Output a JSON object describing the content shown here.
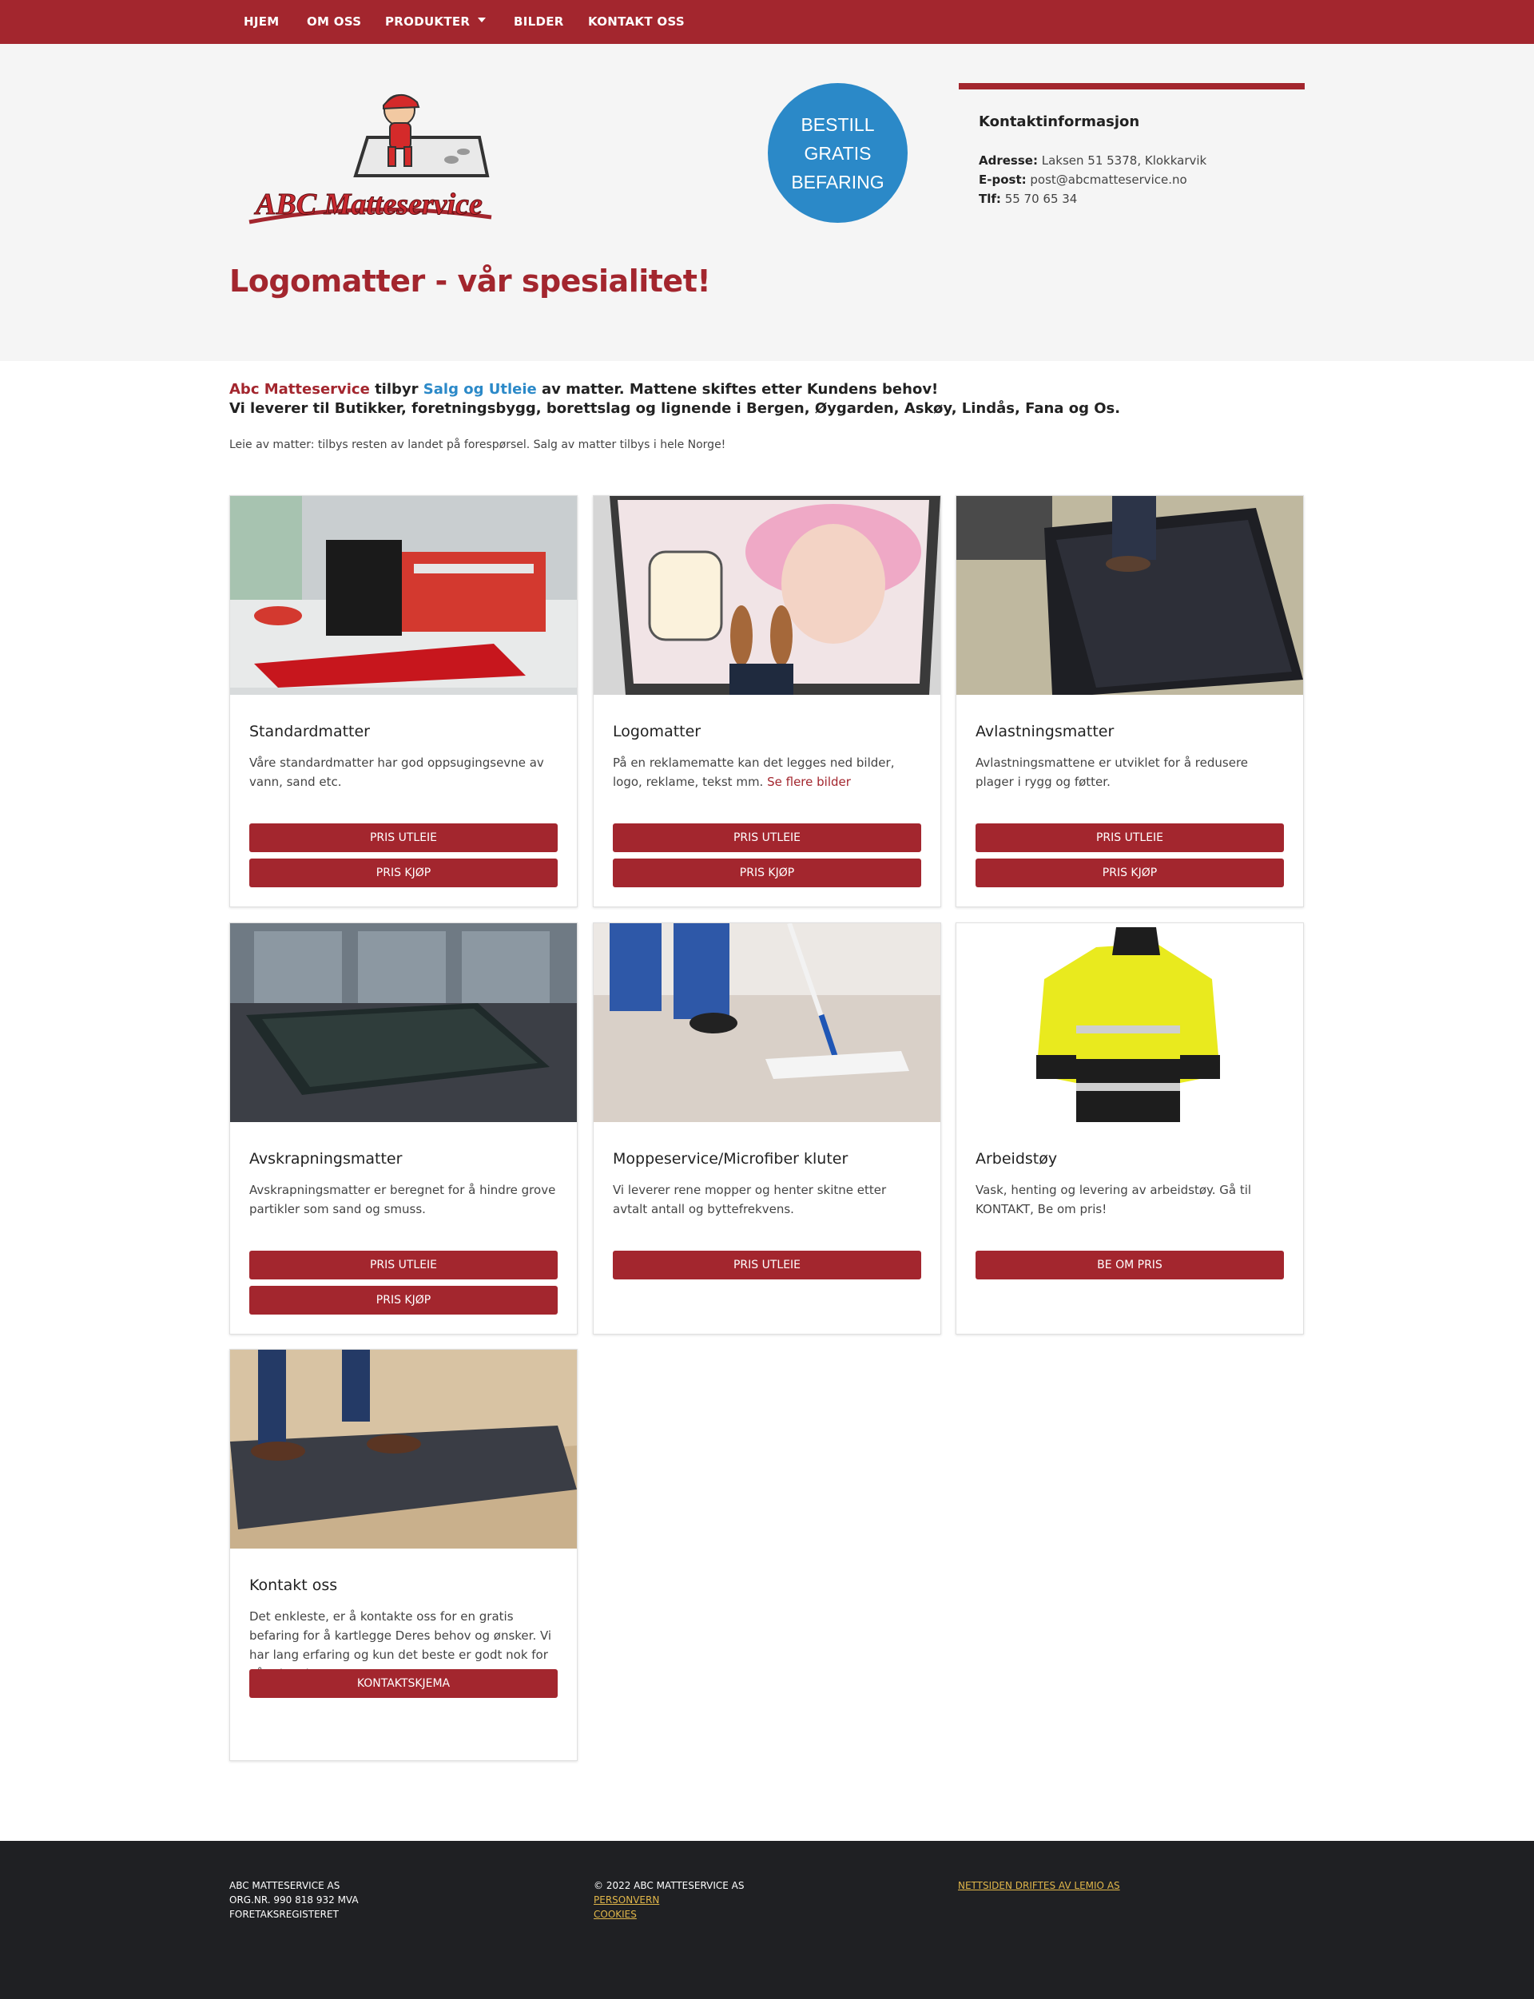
{
  "nav": {
    "items": [
      "HJEM",
      "OM OSS",
      "PRODUKTER",
      "BILDER",
      "KONTAKT OSS"
    ]
  },
  "logo": {
    "text": "ABC Matteservice"
  },
  "cta": {
    "line1": "BESTILL",
    "line2": "GRATIS",
    "line3": "BEFARING"
  },
  "contact": {
    "title": "Kontaktinformasjon",
    "address_label": "Adresse:",
    "address": "Laksen 51 5378, Klokkarvik",
    "email_label": "E-post:",
    "email": "post@abcmatteservice.no",
    "phone_label": "Tlf:",
    "phone": "55 70 65 34"
  },
  "headline": "Logomatter - vår spesialitet!",
  "intro": {
    "brand": "Abc Matteservice",
    "mid1": " tilbyr ",
    "services": "Salg og Utleie",
    "mid2": " av matter. Mattene skiftes etter Kundens behov!",
    "line2": "Vi leverer til Butikker, foretningsbygg, borettslag og lignende i Bergen, Øygarden, Askøy, Lindås, Fana og Os.",
    "note": "Leie av matter: tilbys resten av landet på forespørsel. Salg av matter tilbys i hele Norge!"
  },
  "cards": [
    {
      "title": "Standardmatter",
      "desc": "Våre standardmatter har god oppsugingsevne av vann, sand etc.",
      "buttons": [
        "PRIS UTLEIE",
        "PRIS KJØP"
      ]
    },
    {
      "title": "Logomatter",
      "desc": "På en reklamematte kan det legges ned bilder, logo, reklame, tekst mm.",
      "link": "Se flere bilder",
      "buttons": [
        "PRIS UTLEIE",
        "PRIS KJØP"
      ]
    },
    {
      "title": "Avlastningsmatter",
      "desc": "Avlastningsmattene er utviklet for å redusere plager i rygg og føtter.",
      "buttons": [
        "PRIS UTLEIE",
        "PRIS KJØP"
      ]
    },
    {
      "title": "Avskrapningsmatter",
      "desc": "Avskrapningsmatter er beregnet for å hindre grove partikler som sand og smuss.",
      "buttons": [
        "PRIS UTLEIE",
        "PRIS KJØP"
      ]
    },
    {
      "title": "Moppeservice/Microfiber kluter",
      "desc": "Vi leverer rene mopper og henter skitne etter avtalt antall og byttefrekvens.",
      "buttons": [
        "PRIS UTLEIE"
      ]
    },
    {
      "title": "Arbeidstøy",
      "desc": "Vask, henting og levering av arbeidstøy. Gå til KONTAKT, Be om pris!",
      "buttons": [
        "BE OM PRIS"
      ]
    },
    {
      "title": "Kontakt oss",
      "desc": "Det enkleste, er å kontakte oss for en gratis befaring for å kartlegge Deres behov og ønsker. Vi har lang erfaring og kun det beste er godt nok for våre kunder.",
      "buttons": [
        "KONTAKTSKJEMA"
      ]
    }
  ],
  "footer": {
    "company": "ABC MATTESERVICE AS",
    "orgnr": "ORG.NR. 990 818 932 MVA",
    "register": "FORETAKSREGISTERET",
    "copyright": "© 2022 ABC MATTESERVICE AS",
    "privacy": "PERSONVERN",
    "cookies": "COOKIES",
    "operator": "NETTSIDEN DRIFTES AV LEMIO AS"
  },
  "colors": {
    "brand_red": "#a3262e",
    "accent_blue": "#2b89c8",
    "footer_bg": "#1f2023",
    "footer_link": "#e0b64a"
  }
}
